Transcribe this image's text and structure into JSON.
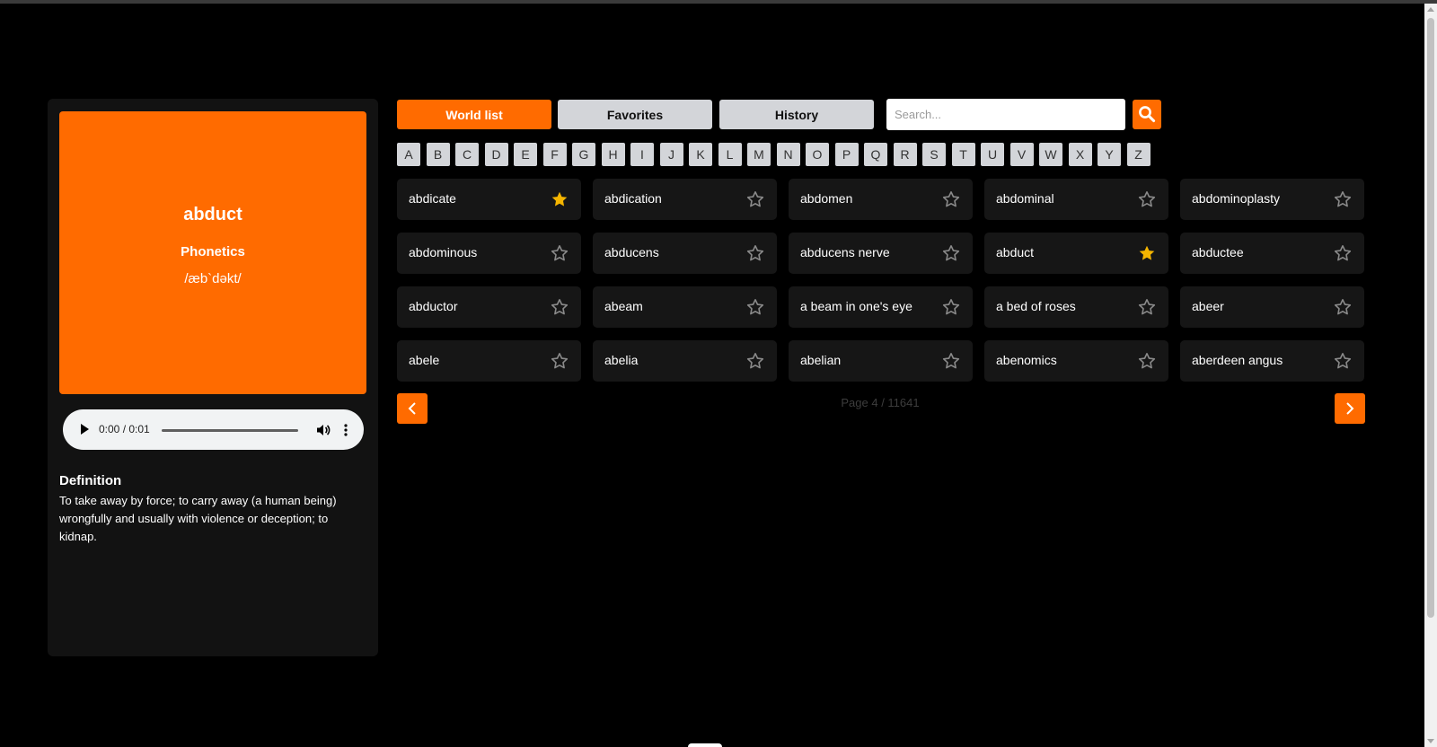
{
  "detail": {
    "word": "abduct",
    "phonetics_label": "Phonetics",
    "phonetics": "/æb`dəkt/",
    "audio_time": "0:00 / 0:01",
    "definition_title": "Definition",
    "definition": "To take away by force; to carry away (a human being) wrongfully and usually with violence or deception; to kidnap."
  },
  "tabs": [
    {
      "label": "World list",
      "active": true
    },
    {
      "label": "Favorites",
      "active": false
    },
    {
      "label": "History",
      "active": false
    }
  ],
  "search": {
    "placeholder": "Search...",
    "icon": "search-icon"
  },
  "letters": [
    "A",
    "B",
    "C",
    "D",
    "E",
    "F",
    "G",
    "H",
    "I",
    "J",
    "K",
    "L",
    "M",
    "N",
    "O",
    "P",
    "Q",
    "R",
    "S",
    "T",
    "U",
    "V",
    "W",
    "X",
    "Y",
    "Z"
  ],
  "words": [
    {
      "label": "abdicate",
      "favorite": true
    },
    {
      "label": "abdication",
      "favorite": false
    },
    {
      "label": "abdomen",
      "favorite": false
    },
    {
      "label": "abdominal",
      "favorite": false
    },
    {
      "label": "abdominoplasty",
      "favorite": false
    },
    {
      "label": "abdominous",
      "favorite": false
    },
    {
      "label": "abducens",
      "favorite": false
    },
    {
      "label": "abducens nerve",
      "favorite": false
    },
    {
      "label": "abduct",
      "favorite": true
    },
    {
      "label": "abductee",
      "favorite": false
    },
    {
      "label": "abductor",
      "favorite": false
    },
    {
      "label": "abeam",
      "favorite": false
    },
    {
      "label": "a beam in one's eye",
      "favorite": false
    },
    {
      "label": "a bed of roses",
      "favorite": false
    },
    {
      "label": "abeer",
      "favorite": false
    },
    {
      "label": "abele",
      "favorite": false
    },
    {
      "label": "abelia",
      "favorite": false
    },
    {
      "label": "abelian",
      "favorite": false
    },
    {
      "label": "abenomics",
      "favorite": false
    },
    {
      "label": "aberdeen angus",
      "favorite": false
    }
  ],
  "pagination": {
    "text": "Page 4 / 11641",
    "prev_icon": "chevron-left-icon",
    "next_icon": "chevron-right-icon"
  },
  "colors": {
    "accent": "#ff6b00",
    "star_active": "#f5b500",
    "star_inactive": "#8a8a8a"
  }
}
